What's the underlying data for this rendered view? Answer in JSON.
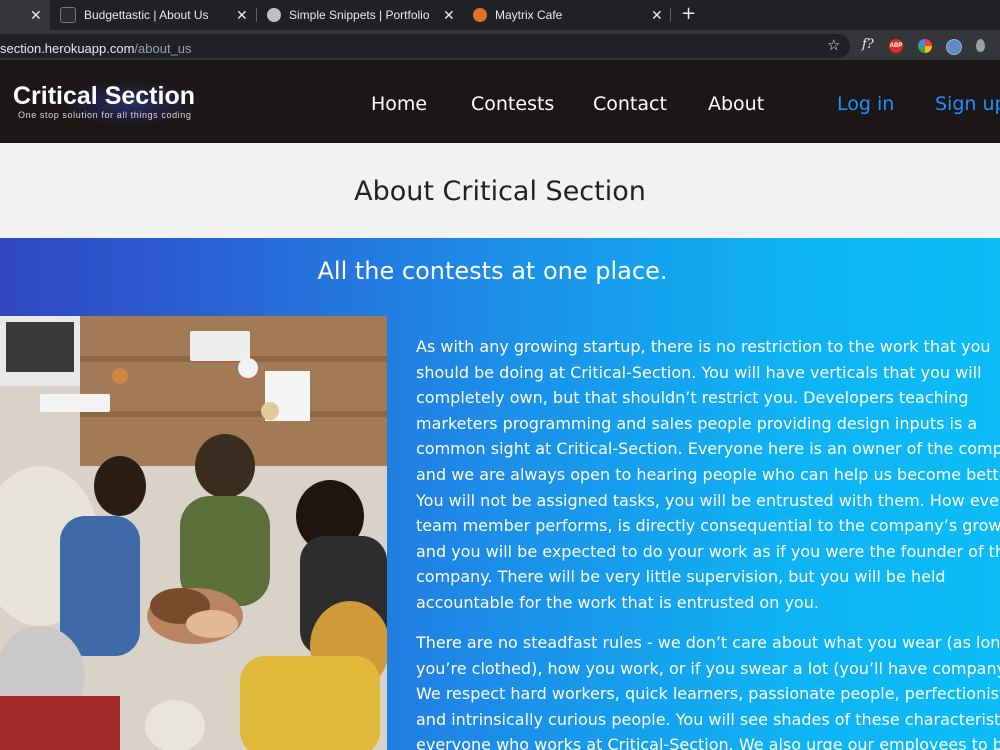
{
  "browser": {
    "tabs": [
      {
        "title": "",
        "close": "✕"
      },
      {
        "title": "Budgettastic | About Us",
        "close": "✕"
      },
      {
        "title": "Simple Snippets | Portfolio",
        "close": "✕"
      },
      {
        "title": "Maytrix Cafe",
        "close": "✕"
      }
    ],
    "new_tab": "+",
    "url_host": "section.herokuapp.com",
    "url_path": "/about_us",
    "star": "☆",
    "ext_f": "f?",
    "ext_abp": "ABP"
  },
  "site": {
    "logo_title": "Critical Section",
    "logo_tagline": "One stop solution for all things coding",
    "nav": [
      "Home",
      "Contests",
      "Contact",
      "About"
    ],
    "auth": [
      "Log in",
      "Sign up"
    ]
  },
  "page": {
    "title": "About Critical Section",
    "heading": "All the contests at one place.",
    "para1": [
      "As with any growing startup, there is no restriction to the work that you",
      "should be doing at Critical-Section. You will have verticals that you will",
      "completely own, but that shouldn’t restrict you. Developers teaching",
      "marketers programming and sales people providing design inputs is a",
      "common sight at Critical-Section. Everyone here is an owner of the company,",
      "and we are always open to hearing people who can help us become better.",
      "You will not be assigned tasks, you will be entrusted with them. How every",
      "team member performs, is directly consequential to the company’s growth,",
      "and you will be expected to do your work as if you were the founder of the",
      "company. There will be very little supervision, but you will be held",
      "accountable for the work that is entrusted on you."
    ],
    "para2": [
      "There are no steadfast rules - we don’t care about what you wear (as long as",
      "you’re clothed), how you work, or if you swear a lot (you’ll have company).",
      "We respect hard workers, quick learners, passionate people, perfectionists",
      "and intrinsically curious people. You will see shades of these characteristics in",
      "everyone who works at Critical-Section. We also urge our employees to be"
    ]
  }
}
